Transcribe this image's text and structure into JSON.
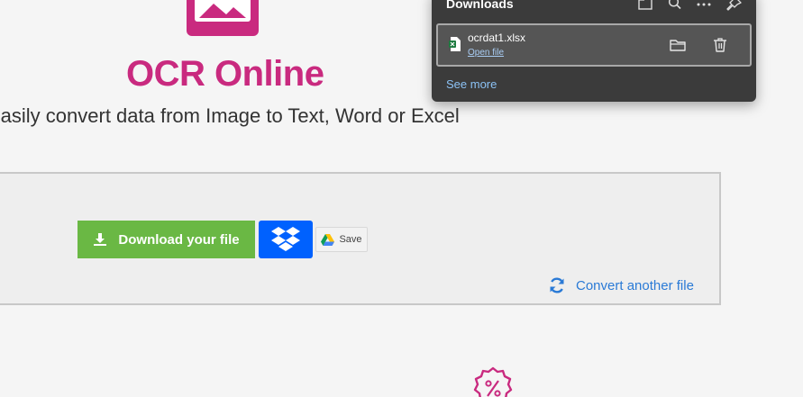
{
  "app": {
    "title": "OCR Online",
    "subtitle": "Easily convert data from Image to Text, Word or Excel",
    "brand_color": "#c92a7f"
  },
  "result": {
    "download_label": "Download your file",
    "download_color": "#6ab844",
    "dropbox_color": "#0061fe",
    "gdrive_save_label": "Save",
    "convert_another_label": "Convert another file",
    "link_color": "#2a7ad6"
  },
  "downloads_panel": {
    "title": "Downloads",
    "header_icons": [
      "open-folder-icon",
      "search-icon",
      "more-options-icon",
      "pin-icon"
    ],
    "items": [
      {
        "file_name": "ocrdat1.xlsx",
        "action_label": "Open file",
        "file_icon": "excel-file-icon",
        "actions": [
          "show-in-folder-icon",
          "delete-icon"
        ]
      }
    ],
    "see_more_label": "See more"
  },
  "icons": {
    "logo": "image-icon",
    "download": "download-icon",
    "dropbox": "dropbox-icon",
    "gdrive": "google-drive-icon",
    "convert": "refresh-icon",
    "badge": "discount-badge-icon"
  }
}
